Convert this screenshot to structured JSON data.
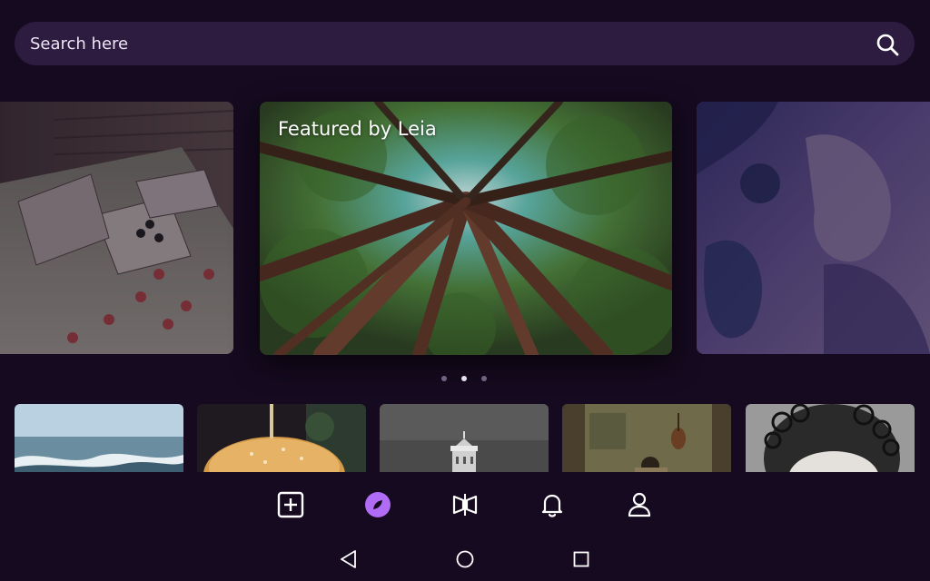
{
  "search": {
    "placeholder": "Search here",
    "icon": "search-icon"
  },
  "carousel": {
    "featured_title": "Featured by Leia",
    "active_index": 1,
    "slides": [
      {
        "name": "playing-cards-image"
      },
      {
        "name": "forest-canopy-image"
      },
      {
        "name": "abstract-purple-image"
      }
    ]
  },
  "thumbnails": [
    {
      "name": "ocean-wave-thumbnail"
    },
    {
      "name": "burger-thumbnail"
    },
    {
      "name": "lighthouse-thumbnail"
    },
    {
      "name": "painting-interior-thumbnail"
    },
    {
      "name": "curly-hair-portrait-thumbnail"
    }
  ],
  "bottom_nav": {
    "items": [
      {
        "icon": "add-square-icon"
      },
      {
        "icon": "explore-compass-icon",
        "active": true
      },
      {
        "icon": "lightfield-view-icon"
      },
      {
        "icon": "bell-icon"
      },
      {
        "icon": "profile-icon"
      }
    ],
    "active_color": "#b06cf5",
    "icon_color": "#ffffff"
  },
  "system_nav": {
    "icons": [
      "back-icon",
      "home-icon",
      "recents-icon"
    ]
  },
  "colors": {
    "background": "#150a1f",
    "search_bg": "#2e1b40",
    "accent": "#b06cf5"
  }
}
